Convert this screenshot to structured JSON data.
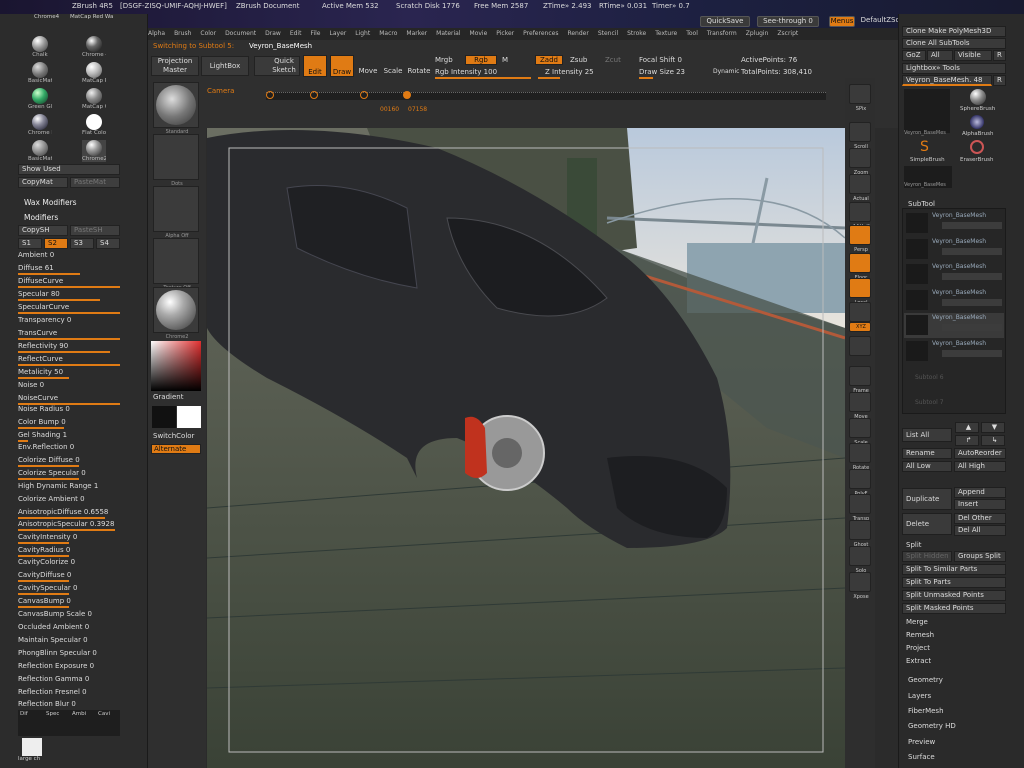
{
  "titlebar": {
    "app": "ZBrush 4R5",
    "session": "[DSGF-ZISQ-UMIF-AQHJ-HWEF]",
    "doc": "ZBrush Document",
    "active_mem": "Active Mem 532",
    "scratch": "Scratch Disk 1776",
    "free_mem": "Free Mem 2587",
    "ztime": "ZTime» 2.493",
    "rtime": "RTime» 0.031",
    "timer": "Timer» 0.7",
    "quicksave": "QuickSave",
    "seethrough": "See-through  0",
    "menus": "Menus",
    "script": "DefaultZScript"
  },
  "menus": [
    "Alpha",
    "Brush",
    "Color",
    "Document",
    "Draw",
    "Edit",
    "File",
    "Layer",
    "Light",
    "Macro",
    "Marker",
    "Material",
    "Movie",
    "Picker",
    "Preferences",
    "Render",
    "Stencil",
    "Stroke",
    "Texture",
    "Tool",
    "Transform",
    "Zplugin",
    "Zscript"
  ],
  "shelf": {
    "switching": "Switching to Subtool 5:",
    "subtool": "Veyron_BaseMesh",
    "projection": "Projection Master",
    "lightbox": "LightBox",
    "quicksketch": "Quick Sketch",
    "edit": "Edit",
    "draw": "Draw",
    "move": "Move",
    "scale": "Scale",
    "rotate": "Rotate",
    "mrgb": "Mrgb",
    "rgb": "Rgb",
    "m": "M",
    "rgb_intensity": "Rgb Intensity 100",
    "zadd": "Zadd",
    "zsub": "Zsub",
    "zcut": "Zcut",
    "z_intensity": "Z Intensity 25",
    "focal_shift": "Focal Shift 0",
    "draw_size": "Draw Size 23",
    "dynamic": "Dynamic",
    "active_points": "ActivePoints: 76",
    "total_points": "TotalPoints: 308,410",
    "camera": "Camera",
    "timeline_a": "00160",
    "timeline_b": "07158"
  },
  "left": {
    "mats_top": [
      "Chrome4",
      "MatCap Red Wa"
    ],
    "mats": [
      "Chalk",
      "Chrome 4",
      "BasicMaterial",
      "MatCap Pearl Ca",
      "Green Glass",
      "MatCap GreenRo",
      "Chrome BrightBlu",
      "Flat Color",
      "BasicMaterial2",
      "Chrome2"
    ],
    "show_used": "Show Used",
    "copymat": "CopyMat",
    "pastemat": "PasteMat",
    "wax": "Wax Modifiers",
    "modifiers": "Modifiers",
    "copysh": "CopySH",
    "pastesh": "PasteSH",
    "s1": "S1",
    "s2": "S2",
    "s3": "S3",
    "s4": "S4",
    "props": [
      {
        "label": "Ambient 0",
        "fill": 0
      },
      {
        "label": "Diffuse 61",
        "fill": 61
      },
      {
        "label": "DiffuseCurve",
        "fill": 100
      },
      {
        "label": "Specular 80",
        "fill": 80
      },
      {
        "label": "SpecularCurve",
        "fill": 100
      },
      {
        "label": "Transparency 0",
        "fill": 0
      },
      {
        "label": "TransCurve",
        "fill": 100
      },
      {
        "label": "Reflectivity 90",
        "fill": 90
      },
      {
        "label": "ReflectCurve",
        "fill": 100
      },
      {
        "label": "Metalicity 50",
        "fill": 50
      },
      {
        "label": "Noise 0",
        "fill": 0
      },
      {
        "label": "NoiseCurve",
        "fill": 100
      },
      {
        "label": "Noise Radius 0",
        "fill": 0
      },
      {
        "label": "Color Bump 0",
        "fill": 45
      },
      {
        "label": "Gel Shading 1",
        "fill": 10
      },
      {
        "label": "Env.Reflection 0",
        "fill": 0
      },
      {
        "label": "Colorize Diffuse 0",
        "fill": 60
      },
      {
        "label": "Colorize Specular 0",
        "fill": 60
      },
      {
        "label": "High Dynamic Range 1",
        "fill": 0
      },
      {
        "label": "Colorize Ambient 0",
        "fill": 0
      },
      {
        "label": "AnisotropicDiffuse 0.6558",
        "fill": 85
      },
      {
        "label": "AnisotropicSpecular 0.3928",
        "fill": 95
      },
      {
        "label": "CavityIntensity 0",
        "fill": 50
      },
      {
        "label": "CavityRadius 0",
        "fill": 50
      },
      {
        "label": "CavityColorize 0",
        "fill": 0
      },
      {
        "label": "CavityDiffuse 0",
        "fill": 50
      },
      {
        "label": "CavitySpecular 0",
        "fill": 50
      },
      {
        "label": "CanvasBump 0",
        "fill": 50
      },
      {
        "label": "CanvasBump Scale 0",
        "fill": 0
      },
      {
        "label": "Occluded   Ambient 0",
        "fill": 0
      },
      {
        "label": "Maintain Specular 0",
        "fill": 0
      },
      {
        "label": "PhongBlinn Specular 0",
        "fill": 0
      },
      {
        "label": "Reflection Exposure 0",
        "fill": 0
      },
      {
        "label": "Reflection Gamma 0",
        "fill": 0
      },
      {
        "label": "Reflection Fresnel 0",
        "fill": 0
      },
      {
        "label": "Reflection Blur 0",
        "fill": 0
      }
    ],
    "tabs": [
      "Dif",
      "Spec",
      "Ambi",
      "Cavi"
    ],
    "large_ch": "large ch"
  },
  "thumbs": {
    "standard": "Standard",
    "dots": "Dots",
    "alpha": "Alpha Off",
    "texture": "Texture Off",
    "chrome": "Chrome2",
    "gradient": "Gradient",
    "switchcolor": "SwitchColor",
    "alternate": "Alternate"
  },
  "ricons": [
    "SPix",
    "Scroll",
    "Zoom",
    "Actual",
    "AAHalf",
    "Persp",
    "Floor",
    "Local",
    "L.Sym",
    "XYZ",
    "",
    "Frame",
    "Move",
    "Scale",
    "Rotate",
    "PolyF",
    "Transp",
    "Ghost",
    "Solo",
    "Xpose"
  ],
  "right": {
    "clone_make": "Clone  Make PolyMesh3D",
    "clone_all": "Clone All SubTools",
    "goz": "GoZ",
    "all": "All",
    "visible": "Visible",
    "r": "R",
    "lightbox_tools": "Lightbox» Tools",
    "veyron_slider": "Veyron_BaseMesh. 48",
    "r2": "R",
    "tool_names": [
      "Veyron_BaseMes",
      "SphereBrush",
      "AlphaBrush",
      "SimpleBrush",
      "EraserBrush",
      "Veyron_BaseMes"
    ],
    "subtool": "SubTool",
    "subtools": [
      "Veyron_BaseMesh",
      "Veyron_BaseMesh",
      "Veyron_BaseMesh",
      "Veyron_BaseMesh",
      "Veyron_BaseMesh",
      "Veyron_BaseMesh"
    ],
    "subtool_extra": [
      "Subtool 6",
      "Subtool 7"
    ],
    "list_all": "List All",
    "rename": "Rename",
    "autoreorder": "AutoReorder",
    "all_low": "All Low",
    "all_high": "All High",
    "duplicate": "Duplicate",
    "append": "Append",
    "insert": "Insert",
    "delete": "Delete",
    "del_other": "Del Other",
    "del_all": "Del All",
    "split": "Split",
    "split_hidden": "Split Hidden",
    "groups_split": "Groups Split",
    "split_similar": "Split To Similar Parts",
    "split_parts": "Split To Parts",
    "split_unmasked": "Split Unmasked Points",
    "split_masked": "Split Masked Points",
    "merge": "Merge",
    "remesh": "Remesh",
    "project": "Project",
    "extract": "Extract",
    "geometry": "Geometry",
    "layers": "Layers",
    "fibermesh": "FiberMesh",
    "geometry_hd": "Geometry HD",
    "preview": "Preview",
    "surface": "Surface"
  },
  "colors": {
    "accent": "#e07b14",
    "panel": "#2c2c2c",
    "viewport": "#5a5a58"
  }
}
